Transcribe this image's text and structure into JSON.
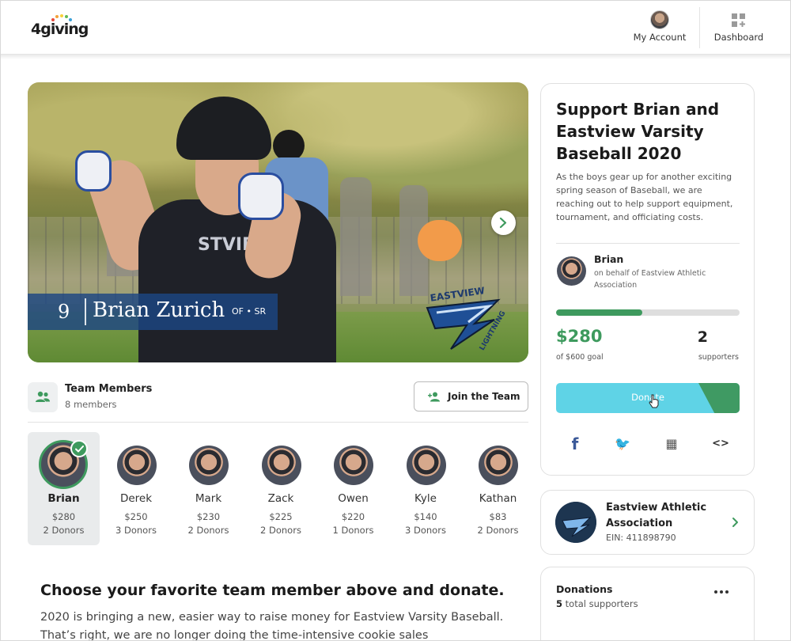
{
  "header": {
    "logo_text": "4giving",
    "account_label": "My Account",
    "dashboard_label": "Dashboard"
  },
  "hero": {
    "player_number": "9",
    "player_name": "Brian Zurich",
    "player_position": "OF • SR",
    "jersey_text": "STVIEW",
    "team_logo_text": "EASTVIEW",
    "team_logo_sub": "LIGHTNING"
  },
  "team": {
    "title": "Team Members",
    "count": "8 members",
    "join_label": "Join the Team",
    "members": [
      {
        "name": "Brian",
        "amount": "$280",
        "donors": "2 Donors",
        "selected": true
      },
      {
        "name": "Derek",
        "amount": "$250",
        "donors": "3 Donors"
      },
      {
        "name": "Mark",
        "amount": "$230",
        "donors": "2 Donors"
      },
      {
        "name": "Zack",
        "amount": "$225",
        "donors": "2 Donors"
      },
      {
        "name": "Owen",
        "amount": "$220",
        "donors": "1 Donors"
      },
      {
        "name": "Kyle",
        "amount": "$140",
        "donors": "3 Donors"
      },
      {
        "name": "Kathan",
        "amount": "$83",
        "donors": "2 Donors"
      }
    ]
  },
  "content": {
    "choose_title": "Choose your favorite team member above and donate.",
    "choose_body": "2020 is bringing a new, easier way to raise money for Eastview Varsity Baseball. That’s right, we are no longer doing the time-intensive cookie sales"
  },
  "campaign": {
    "title": "Support Brian and Eastview Varsity Baseball 2020",
    "description": "As the boys gear up for another exciting spring season of Baseball, we are reaching out to help support equipment, tournament, and officiating costs.",
    "fundraiser_name": "Brian",
    "fundraiser_behalf": "on behalf of Eastview Athletic Association",
    "raised": "$280",
    "goal": "of $600 goal",
    "progress_fraction": 0.47,
    "supporters_count": "2",
    "supporters_label": "supporters",
    "donate_label": "Donate",
    "share": [
      {
        "icon": "facebook-icon",
        "glyph": "f",
        "color": "#3b5998"
      },
      {
        "icon": "twitter-icon",
        "glyph": "🐦",
        "color": "#1da1f2"
      },
      {
        "icon": "qr-code-icon",
        "glyph": "▦",
        "color": "#555555"
      },
      {
        "icon": "embed-code-icon",
        "glyph": "<>",
        "color": "#333333"
      }
    ]
  },
  "organization": {
    "name": "Eastview Athletic Association",
    "ein": "EIN: 411898790"
  },
  "donations": {
    "title": "Donations",
    "count": "5",
    "count_suffix": " total supporters"
  },
  "colors": {
    "accent_green": "#3e9a5e",
    "donate_cyan": "#5fd3e6"
  }
}
